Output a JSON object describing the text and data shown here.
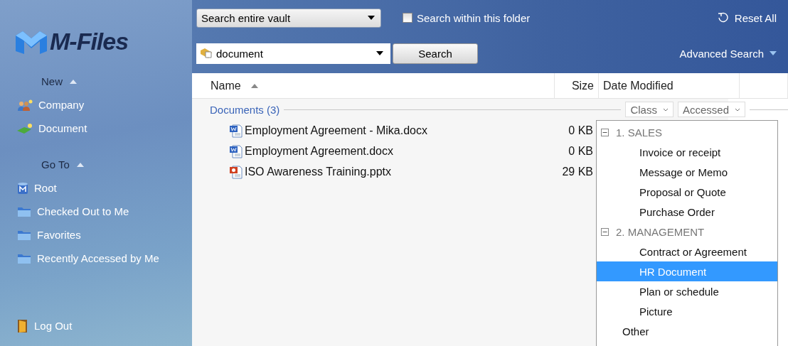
{
  "logo": {
    "text": "M-Files"
  },
  "sidebar": {
    "sections": [
      {
        "title": "New",
        "expanded": true,
        "items": [
          {
            "label": "Company",
            "kind": "people"
          },
          {
            "label": "Document",
            "kind": "document"
          }
        ]
      },
      {
        "title": "Go To",
        "expanded": true,
        "items": [
          {
            "label": "Root",
            "kind": "vault"
          },
          {
            "label": "Checked Out to Me",
            "kind": "folder"
          },
          {
            "label": "Favorites",
            "kind": "folder"
          },
          {
            "label": "Recently Accessed by Me",
            "kind": "folder"
          }
        ]
      }
    ],
    "logout": {
      "label": "Log Out"
    }
  },
  "search": {
    "scope": "Search entire vault",
    "within_folder": {
      "label": "Search within this folder",
      "checked": false
    },
    "query": "document",
    "button": "Search",
    "reset": "Reset All",
    "advanced": "Advanced Search"
  },
  "table": {
    "columns": [
      {
        "label": "Name",
        "sorted": true
      },
      {
        "label": "Size",
        "sorted": false
      },
      {
        "label": "Date Modified",
        "sorted": false
      }
    ],
    "group": {
      "label": "Documents (3)",
      "filters": [
        "Class",
        "Accessed"
      ]
    },
    "rows": [
      {
        "name": "Employment Agreement - Mika.docx",
        "size": "0 KB",
        "kind": "word"
      },
      {
        "name": "Employment Agreement.docx",
        "size": "0 KB",
        "kind": "word"
      },
      {
        "name": "ISO Awareness Training.pptx",
        "size": "29 KB",
        "kind": "powerpoint"
      }
    ]
  },
  "class_menu": {
    "items": [
      {
        "label": "1. SALES",
        "expanded": true,
        "children": [
          {
            "label": "Invoice or receipt",
            "selected": false
          },
          {
            "label": "Message or Memo",
            "selected": false
          },
          {
            "label": "Proposal or Quote",
            "selected": false
          },
          {
            "label": "Purchase Order",
            "selected": false
          }
        ]
      },
      {
        "label": "2. MANAGEMENT",
        "expanded": true,
        "children": [
          {
            "label": "Contract or Agreement",
            "selected": false
          },
          {
            "label": "HR Document",
            "selected": true
          },
          {
            "label": "Plan or schedule",
            "selected": false
          },
          {
            "label": "Picture",
            "selected": false
          }
        ]
      },
      {
        "label": "Other",
        "selected": false
      }
    ]
  }
}
